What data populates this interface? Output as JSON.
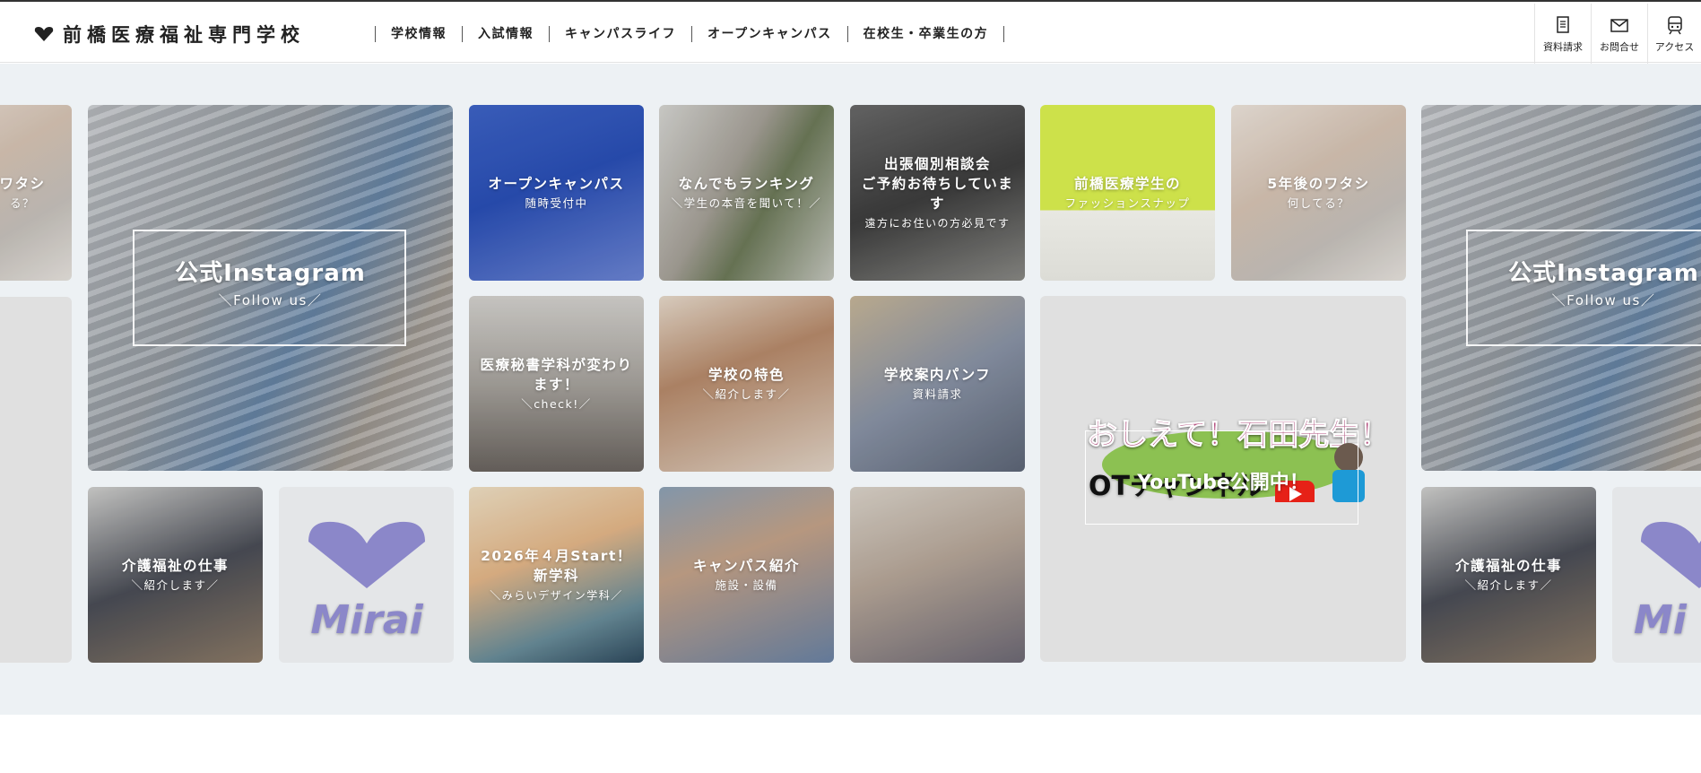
{
  "header": {
    "logo_text": "前橋医療福祉専門学校",
    "nav": [
      "学校情報",
      "入試情報",
      "キャンパスライフ",
      "オープンキャンパス",
      "在校生・卒業生の方"
    ],
    "utility": [
      {
        "label": "資料請求",
        "icon": "document-icon"
      },
      {
        "label": "お問合せ",
        "icon": "mail-icon"
      },
      {
        "label": "アクセス",
        "icon": "train-icon"
      }
    ]
  },
  "tiles": {
    "left_partial_top": {
      "title": "ワタシ",
      "sub": "る？"
    },
    "instagram": {
      "title": "公式Instagram",
      "sub": "＼Follow us／"
    },
    "opencampus": {
      "title": "オープンキャンパス",
      "sub": "随時受付中"
    },
    "ranking": {
      "title": "なんでもランキング",
      "sub": "＼学生の本音を聞いて！／"
    },
    "consult": {
      "title": "出張個別相談会\nご予約お待ちしています",
      "sub": "遠方にお住いの方必見です"
    },
    "fashion": {
      "title": "前橋医療学生の",
      "sub": "ファッションスナップ"
    },
    "future": {
      "title": "5年後のワタシ",
      "sub": "何してる？"
    },
    "instagram2": {
      "title": "公式Instagram",
      "sub": "＼Follow us／"
    },
    "secretary": {
      "title": "医療秘書学科が変わります！",
      "sub": "＼check!／"
    },
    "feature": {
      "title": "学校の特色",
      "sub": "＼紹介します／"
    },
    "pamphlet": {
      "title": "学校案内パンフ",
      "sub": "資料請求"
    },
    "youtube": {
      "title": "YouTube公開中！",
      "art_text": "おしえて！石田先生！",
      "art_sub": "OTチャンネル"
    },
    "care": {
      "title": "介護福祉の仕事",
      "sub": "＼紹介します／"
    },
    "mirai": {
      "logo_text": "Mirai"
    },
    "newdept": {
      "title": "2026年４月Start！\n新学科",
      "sub": "＼みらいデザイン学科／"
    },
    "campus": {
      "title": "キャンパス紹介",
      "sub": "施設・設備"
    },
    "care2": {
      "title": "介護福祉の仕事",
      "sub": "＼紹介します／"
    },
    "mirai2": {
      "logo_text": "Mi"
    }
  },
  "colors": {
    "accent": "#cde14a",
    "mirai_purple": "#8b87c9",
    "youtube_red": "#e62117",
    "background": "#edf1f4"
  }
}
